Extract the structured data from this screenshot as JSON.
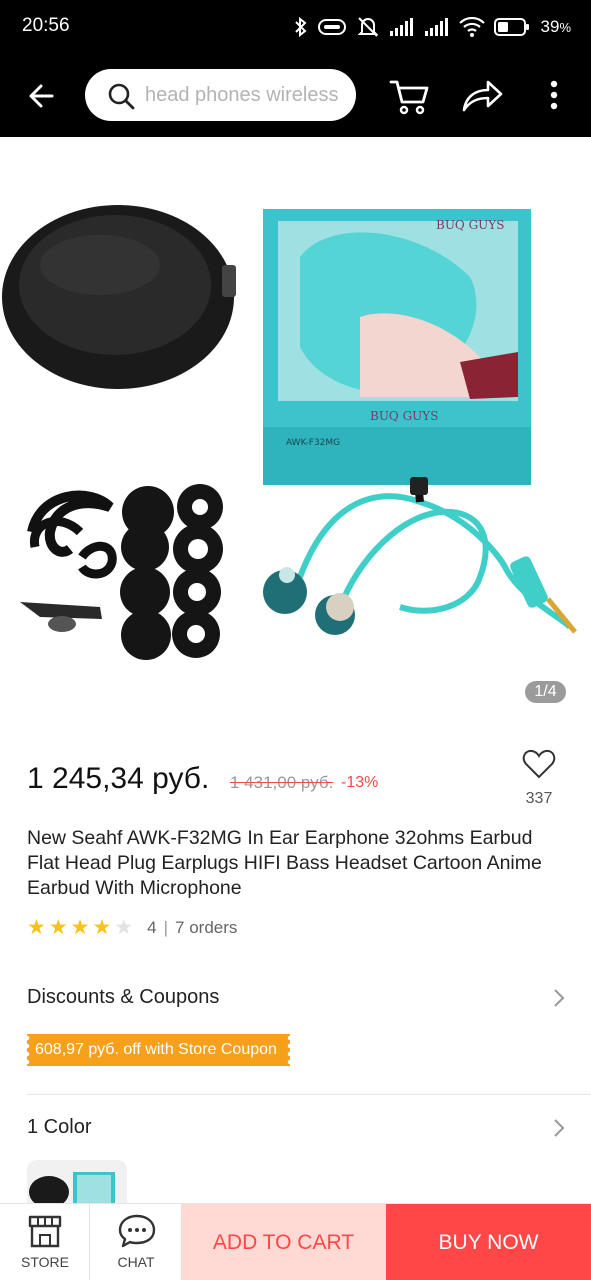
{
  "status_bar": {
    "time": "20:56",
    "battery_percent": "39",
    "battery_suffix": "%",
    "icons": [
      "bluetooth-icon",
      "vpn-key-icon",
      "mute-icon",
      "signal-icon",
      "signal-icon",
      "wifi-icon",
      "battery-icon"
    ]
  },
  "header": {
    "search_text": "head phones wireless",
    "icons": [
      "back-arrow-icon",
      "search-icon",
      "cart-icon",
      "share-icon",
      "more-vertical-icon"
    ]
  },
  "gallery": {
    "counter": "1/4",
    "box_brand": "BUQ GUYS",
    "box_model": "AWK-F32MG",
    "box_colors": {
      "box": "#36c2c9",
      "cable": "#3fcfc8",
      "case": "#1a1a1a"
    }
  },
  "product": {
    "price": "1 245,34 руб.",
    "old_price": "1 431,00 руб.",
    "discount": "-13%",
    "wishlist_count": "337",
    "title": "New Seahf AWK-F32MG In Ear Earphone 32ohms Earbud Flat Head Plug Earplugs HIFI Bass Headset Cartoon Anime Earbud With Microphone",
    "rating": {
      "filled_stars": 4,
      "total_stars": 5,
      "value": "4",
      "separator": "|",
      "orders": "7 orders"
    }
  },
  "discounts": {
    "label": "Discounts & Coupons",
    "coupon": "608,97 руб. off with Store Coupon"
  },
  "color": {
    "label": "1 Color"
  },
  "bottom_bar": {
    "store_label": "STORE",
    "chat_label": "CHAT",
    "add_to_cart": "ADD TO CART",
    "buy_now": "BUY NOW"
  },
  "colors": {
    "accent": "#ff4747",
    "add_to_cart_bg": "#ffd9d4",
    "coupon_bg": "#f7a01b",
    "star": "#f7c31b",
    "header_bg": "#000000"
  }
}
